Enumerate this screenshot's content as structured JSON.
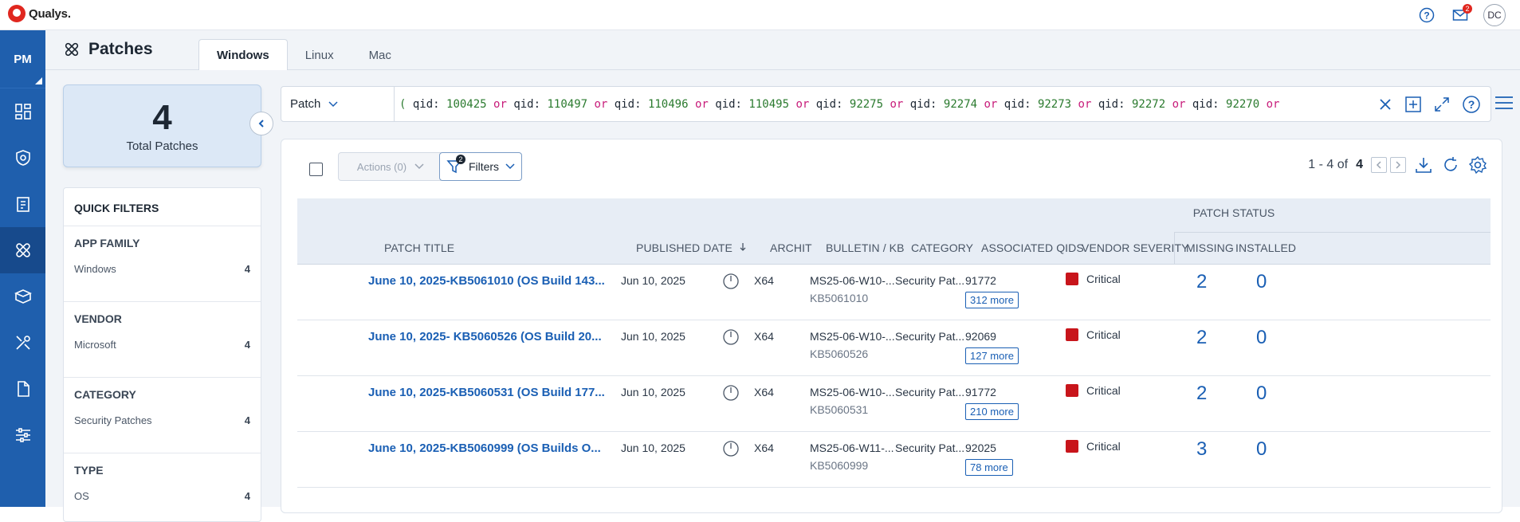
{
  "app": {
    "brand": "Qualys.",
    "module_abbr": "PM",
    "user_initials": "DC",
    "mail_badge": "2"
  },
  "header": {
    "title": "Patches",
    "tabs": [
      {
        "label": "Windows"
      },
      {
        "label": "Linux"
      },
      {
        "label": "Mac"
      }
    ]
  },
  "summary": {
    "total": "4",
    "total_label": "Total Patches"
  },
  "quick_filters": {
    "title": "QUICK FILTERS",
    "groups": [
      {
        "title": "APP FAMILY",
        "item": "Windows",
        "count": "4"
      },
      {
        "title": "VENDOR",
        "item": "Microsoft",
        "count": "4"
      },
      {
        "title": "CATEGORY",
        "item": "Security Patches",
        "count": "4"
      },
      {
        "title": "TYPE",
        "item": "OS",
        "count": "4"
      }
    ]
  },
  "query": {
    "type": "Patch",
    "open_paren": "(",
    "key": "qid:",
    "op": "or",
    "qids": [
      "100425",
      "110497",
      "110496",
      "110495",
      "92275",
      "92274",
      "92273",
      "92272",
      "92270"
    ]
  },
  "toolbar": {
    "actions_label": "Actions (0)",
    "filters_label": "Filters",
    "filters_badge": "2",
    "pager_text": "1 - 4 of",
    "pager_total": "4"
  },
  "table": {
    "group_header": "PATCH STATUS",
    "columns": {
      "title": "PATCH TITLE",
      "published": "PUBLISHED DATE",
      "arch": "ARCHIT",
      "bulletin": "BULLETIN / KB",
      "category": "CATEGORY",
      "qids": "ASSOCIATED QIDS",
      "severity": "VENDOR SEVERITY",
      "missing": "MISSING",
      "installed": "INSTALLED"
    },
    "rows": [
      {
        "title": "June 10, 2025-KB5061010 (OS Build 143...",
        "published": "Jun 10, 2025",
        "arch": "X64",
        "bulletin": "MS25-06-W10-...",
        "kb": "KB5061010",
        "category": "Security Pat...",
        "qid": "91772",
        "more": "312 more",
        "severity": "Critical",
        "missing": "2",
        "installed": "0"
      },
      {
        "title": "June 10, 2025- KB5060526 (OS Build 20...",
        "published": "Jun 10, 2025",
        "arch": "X64",
        "bulletin": "MS25-06-W10-...",
        "kb": "KB5060526",
        "category": "Security Pat...",
        "qid": "92069",
        "more": "127 more",
        "severity": "Critical",
        "missing": "2",
        "installed": "0"
      },
      {
        "title": "June 10, 2025-KB5060531 (OS Build 177...",
        "published": "Jun 10, 2025",
        "arch": "X64",
        "bulletin": "MS25-06-W10-...",
        "kb": "KB5060531",
        "category": "Security Pat...",
        "qid": "91772",
        "more": "210 more",
        "severity": "Critical",
        "missing": "2",
        "installed": "0"
      },
      {
        "title": "June 10, 2025-KB5060999 (OS Builds O...",
        "published": "Jun 10, 2025",
        "arch": "X64",
        "bulletin": "MS25-06-W11-...",
        "kb": "KB5060999",
        "category": "Security Pat...",
        "qid": "92025",
        "more": "78 more",
        "severity": "Critical",
        "missing": "3",
        "installed": "0"
      }
    ]
  },
  "colors": {
    "accent": "#1f5fad",
    "link": "#1a5fb4",
    "critical": "#c8151b",
    "brand_red": "#e0271f"
  }
}
